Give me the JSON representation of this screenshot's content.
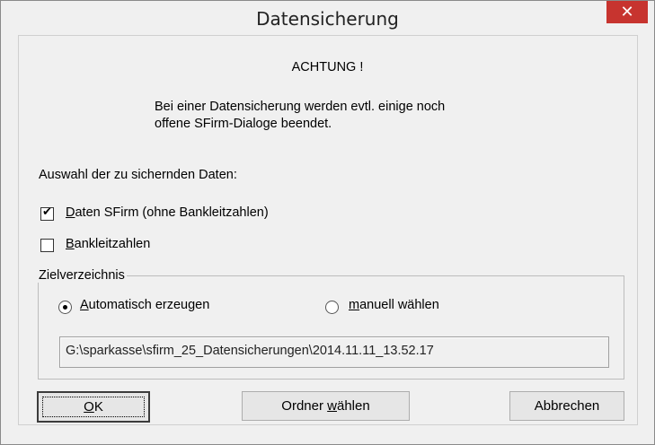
{
  "window": {
    "title": "Datensicherung",
    "close_glyph": "✕"
  },
  "warning": {
    "heading": "ACHTUNG !",
    "line1": "Bei einer Datensicherung werden evtl. einige noch",
    "line2": "offene SFirm-Dialoge beendet."
  },
  "selection": {
    "label": "Auswahl der zu sichernden Daten:",
    "checkbox_data": {
      "label_u": "D",
      "label_rest": "aten SFirm (ohne Bankleitzahlen)",
      "checked": true
    },
    "checkbox_blz": {
      "label_u": "B",
      "label_rest": "ankleitzahlen",
      "checked": false
    }
  },
  "target": {
    "group_label": "Zielverzeichnis",
    "radio_auto": {
      "label_u": "A",
      "label_rest": "utomatisch erzeugen",
      "selected": true
    },
    "radio_manual": {
      "label_u": "m",
      "label_rest": "anuell wählen",
      "selected": false
    },
    "path": "G:\\sparkasse\\sfirm_25_Datensicherungen\\2014.11.11_13.52.17"
  },
  "buttons": {
    "ok": {
      "label_u": "O",
      "label_rest": "K"
    },
    "folder": {
      "label_pre": "Ordner ",
      "label_u": "w",
      "label_rest": "ählen"
    },
    "cancel": {
      "label": "Abbrechen"
    }
  },
  "colors": {
    "close_button": "#c7342f",
    "dialog_bg": "#f0f0f0"
  }
}
